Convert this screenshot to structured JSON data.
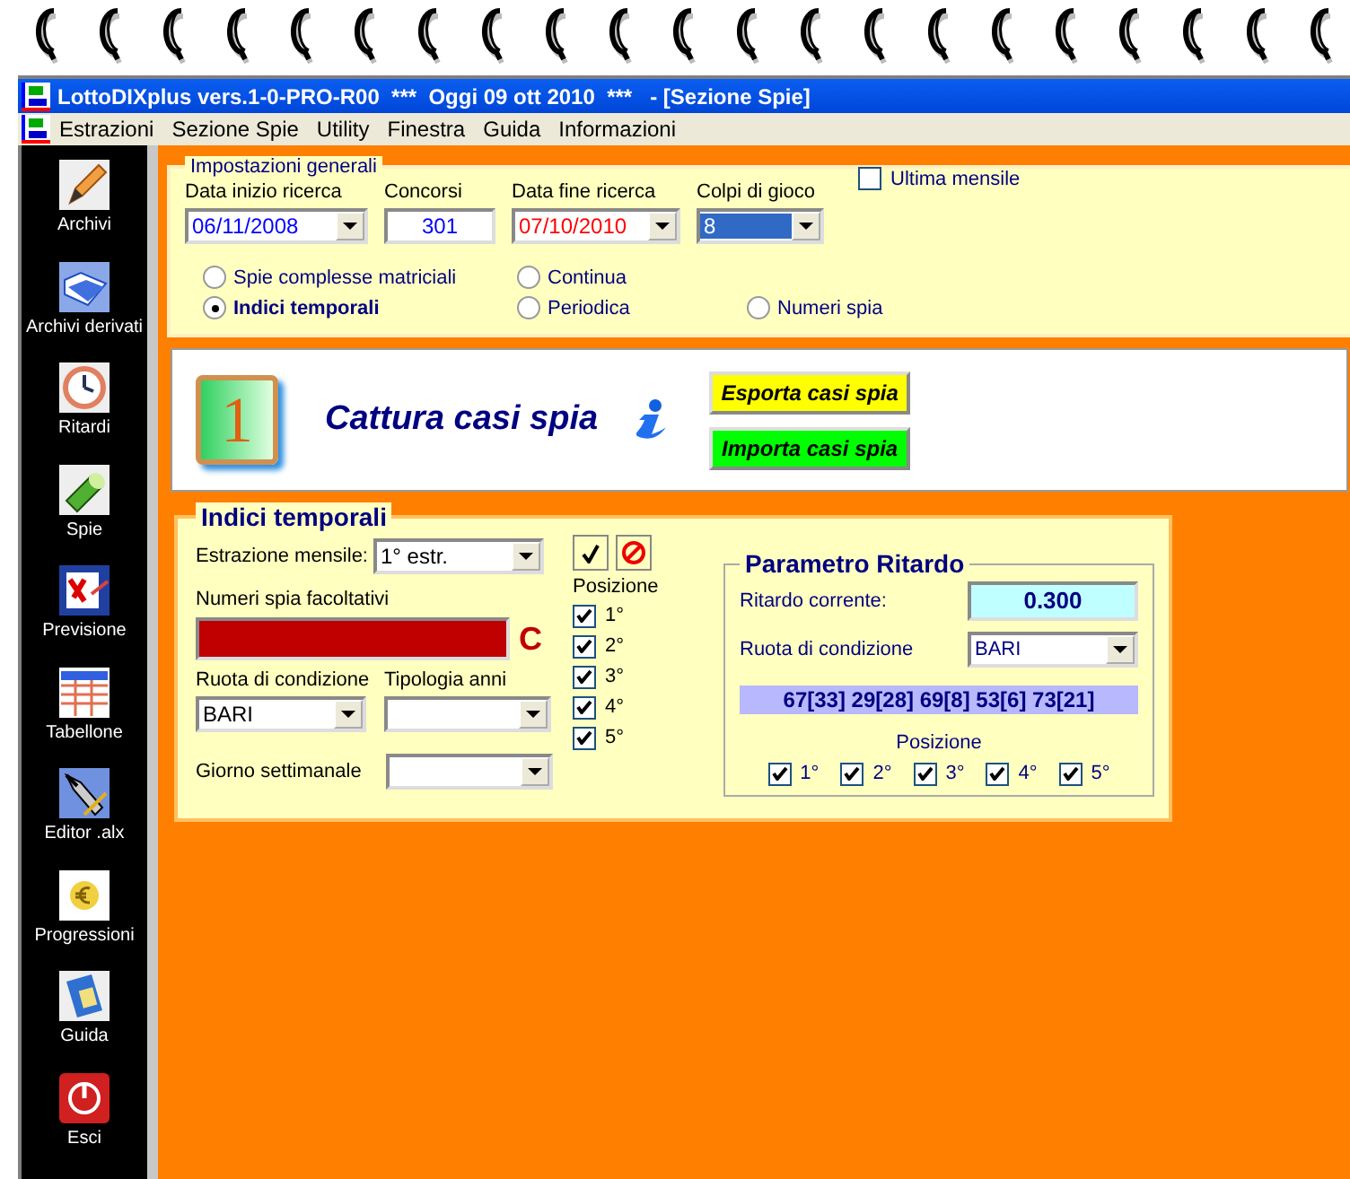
{
  "window": {
    "title": "LottoDIXplus vers.1-0-PRO-R00  ***  Oggi 09 ott 2010  ***   - [Sezione Spie]"
  },
  "menu": [
    "Estrazioni",
    "Sezione Spie",
    "Utility",
    "Finestra",
    "Guida",
    "Informazioni"
  ],
  "sidebar": [
    {
      "label": "Archivi"
    },
    {
      "label": "Archivi derivati"
    },
    {
      "label": "Ritardi"
    },
    {
      "label": "Spie"
    },
    {
      "label": "Previsione"
    },
    {
      "label": "Tabellone"
    },
    {
      "label": "Editor .alx"
    },
    {
      "label": "Progressioni"
    },
    {
      "label": "Guida"
    },
    {
      "label": "Esci"
    }
  ],
  "general": {
    "title": "Impostazioni generali",
    "fields": [
      {
        "label": "Data inizio ricerca",
        "value": "06/11/2008",
        "kind": "dropdown",
        "color": "#0000ff",
        "highlighted": false
      },
      {
        "label": "Concorsi",
        "value": "301",
        "kind": "number",
        "color": "#0000ff",
        "highlighted": false
      },
      {
        "label": "Data fine ricerca",
        "value": "07/10/2010",
        "kind": "dropdown",
        "color": "#ff0000",
        "highlighted": false
      },
      {
        "label": "Colpi di gioco",
        "value": "8",
        "kind": "dropdown",
        "highlighted": true
      }
    ],
    "ultima_mensile": {
      "label": "Ultima mensile",
      "checked": false
    },
    "radios": [
      {
        "label": "Spie complesse matriciali",
        "selected": false
      },
      {
        "label": "Indici temporali",
        "selected": true
      },
      {
        "label": "Continua",
        "selected": false
      },
      {
        "label": "Periodica",
        "selected": false
      },
      {
        "label": "Numeri spia",
        "selected": false
      }
    ]
  },
  "capture": {
    "badge": "1",
    "title": "Cattura casi spia",
    "buttons": [
      {
        "label": "Esporta casi spia",
        "color": "#ffff00"
      },
      {
        "label": "Importa casi spia",
        "color": "#00ff00"
      }
    ]
  },
  "indici": {
    "title": "Indici temporali",
    "estrazione": {
      "label": "Estrazione mensile:",
      "value": "1° estr."
    },
    "numeri_label": "Numeri spia facoltativi",
    "clear_button": "C",
    "ruota": {
      "label": "Ruota di condizione",
      "value": "BARI"
    },
    "tipologia": {
      "label": "Tipologia anni"
    },
    "giorno": {
      "label": "Giorno settimanale"
    },
    "posizione": {
      "title": "Posizione",
      "items": [
        {
          "label": "1°",
          "checked": true
        },
        {
          "label": "2°",
          "checked": true
        },
        {
          "label": "3°",
          "checked": true
        },
        {
          "label": "4°",
          "checked": true
        },
        {
          "label": "5°",
          "checked": true
        }
      ]
    }
  },
  "ritardo": {
    "title": "Parametro Ritardo",
    "current_label": "Ritardo corrente:",
    "current_value": "0.300",
    "ruota_label": "Ruota di condizione",
    "ruota_value": "BARI",
    "numbers": "67[33] 29[28] 69[8] 53[6] 73[21]",
    "posizione_title": "Posizione",
    "items": [
      {
        "label": "1°",
        "checked": true
      },
      {
        "label": "2°",
        "checked": true
      },
      {
        "label": "3°",
        "checked": true
      },
      {
        "label": "4°",
        "checked": true
      },
      {
        "label": "5°",
        "checked": true
      }
    ]
  }
}
